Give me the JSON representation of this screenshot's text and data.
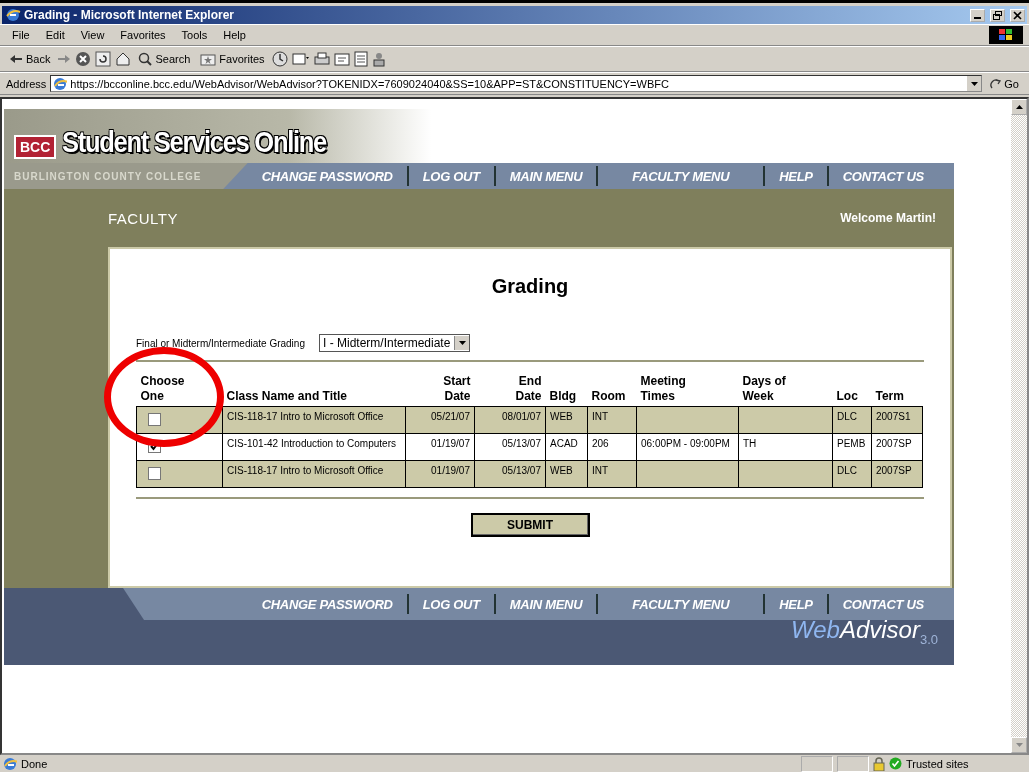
{
  "window": {
    "title": "Grading - Microsoft Internet Explorer"
  },
  "menu": [
    "File",
    "Edit",
    "View",
    "Favorites",
    "Tools",
    "Help"
  ],
  "toolbar": {
    "back": "Back",
    "search": "Search",
    "favorites": "Favorites"
  },
  "address": {
    "label": "Address",
    "url": "https://bcconline.bcc.edu/WebAdvisor/WebAdvisor?TOKENIDX=7609024040&SS=10&APP=ST&CONSTITUENCY=WBFC",
    "go": "Go"
  },
  "banner": {
    "logo": "BCC",
    "title": "Student Services Online",
    "college": "BURLINGTON COUNTY COLLEGE"
  },
  "nav": [
    "CHANGE PASSWORD",
    "LOG OUT",
    "MAIN MENU",
    "FACULTY MENU",
    "HELP",
    "CONTACT US"
  ],
  "section": "FACULTY",
  "welcome": "Welcome Martin!",
  "heading": "Grading",
  "grading_select": {
    "label": "Final or Midterm/Intermediate Grading",
    "value": "I - Midterm/Intermediate"
  },
  "table": {
    "columns": [
      "Choose One",
      "Class Name and Title",
      "Start Date",
      "End Date",
      "Bldg",
      "Room",
      "Meeting Times",
      "Days of Week",
      "Loc",
      "Term"
    ],
    "rows": [
      {
        "checked": false,
        "cells": [
          "",
          "CIS-118-17 Intro to Microsoft Office",
          "05/21/07",
          "08/01/07",
          "WEB",
          "INT",
          "",
          "",
          "DLC",
          "2007S1"
        ]
      },
      {
        "checked": true,
        "cells": [
          "",
          "CIS-101-42 Introduction to Computers",
          "01/19/07",
          "05/13/07",
          "ACAD",
          "206",
          "06:00PM - 09:00PM",
          "TH",
          "PEMB",
          "2007SP"
        ]
      },
      {
        "checked": false,
        "cells": [
          "",
          "CIS-118-17 Intro to Microsoft Office",
          "01/19/07",
          "05/13/07",
          "WEB",
          "INT",
          "",
          "",
          "DLC",
          "2007SP"
        ]
      }
    ]
  },
  "submit": "SUBMIT",
  "footer_nav": [
    "CHANGE PASSWORD",
    "LOG OUT",
    "MAIN MENU",
    "FACULTY MENU",
    "HELP",
    "CONTACT US"
  ],
  "footer_logo": {
    "web": "Web",
    "advisor": "Advisor",
    "version": "3.0"
  },
  "status_bar": {
    "text": "Done",
    "zone": "Trusted sites"
  }
}
